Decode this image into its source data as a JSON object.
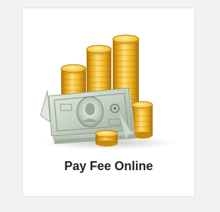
{
  "tile": {
    "label": "Pay Fee Online",
    "icon": "coins-and-banknotes-icon"
  },
  "colors": {
    "page_background": "#f2f2f2",
    "card_background": "#ffffff",
    "card_border": "#e1e1e1",
    "label_text": "#222222",
    "coin_gold": "#f2b51e",
    "coin_dark": "#b97c08",
    "banknote_green": "#c7d3c4"
  }
}
